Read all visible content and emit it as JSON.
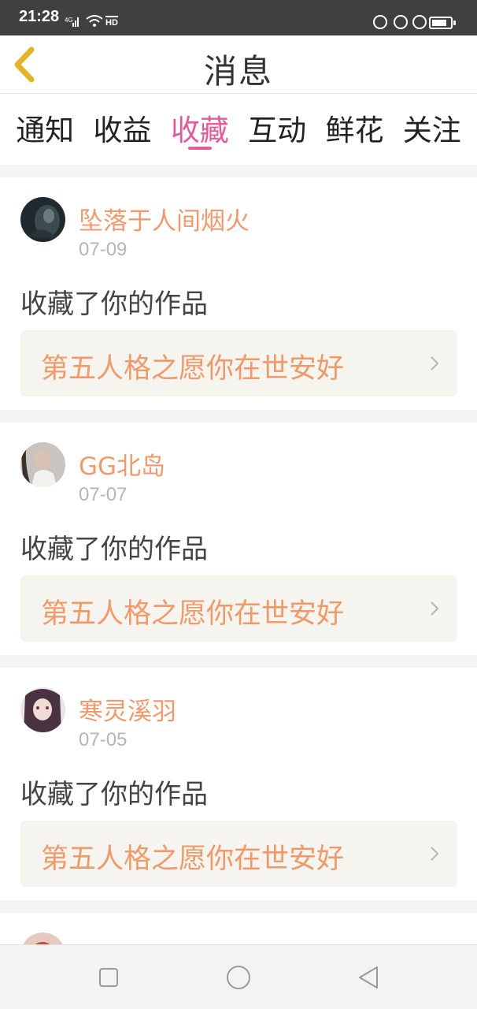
{
  "status_bar": {
    "time": "21:28",
    "network": "4G",
    "hd": "HD",
    "icons": [
      "signal-icon",
      "wifi-icon",
      "moon-icon",
      "lock-icon",
      "alarm-icon",
      "battery-icon"
    ]
  },
  "header": {
    "title": "消息",
    "back_icon": "chevron-left-icon"
  },
  "tabs": [
    {
      "label": "通知",
      "active": false
    },
    {
      "label": "收益",
      "active": false
    },
    {
      "label": "收藏",
      "active": true
    },
    {
      "label": "互动",
      "active": false
    },
    {
      "label": "鲜花",
      "active": false
    },
    {
      "label": "关注",
      "active": false
    }
  ],
  "notifications": [
    {
      "user": "坠落于人间烟火",
      "date": "07-09",
      "action": "收藏了你的作品",
      "work_title": "第五人格之愿你在世安好"
    },
    {
      "user": "GG北岛",
      "date": "07-07",
      "action": "收藏了你的作品",
      "work_title": "第五人格之愿你在世安好"
    },
    {
      "user": "寒灵溪羽",
      "date": "07-05",
      "action": "收藏了你的作品",
      "work_title": "第五人格之愿你在世安好"
    }
  ],
  "colors": {
    "accent_pink": "#e25c9a",
    "username_orange": "#f09a6b",
    "status_bar_bg": "#404040",
    "card_bg": "#ffffff",
    "work_bg": "#f5f4ee"
  },
  "nav_bar": {
    "buttons": [
      "recent-apps-icon",
      "home-icon",
      "back-triangle-icon"
    ]
  }
}
